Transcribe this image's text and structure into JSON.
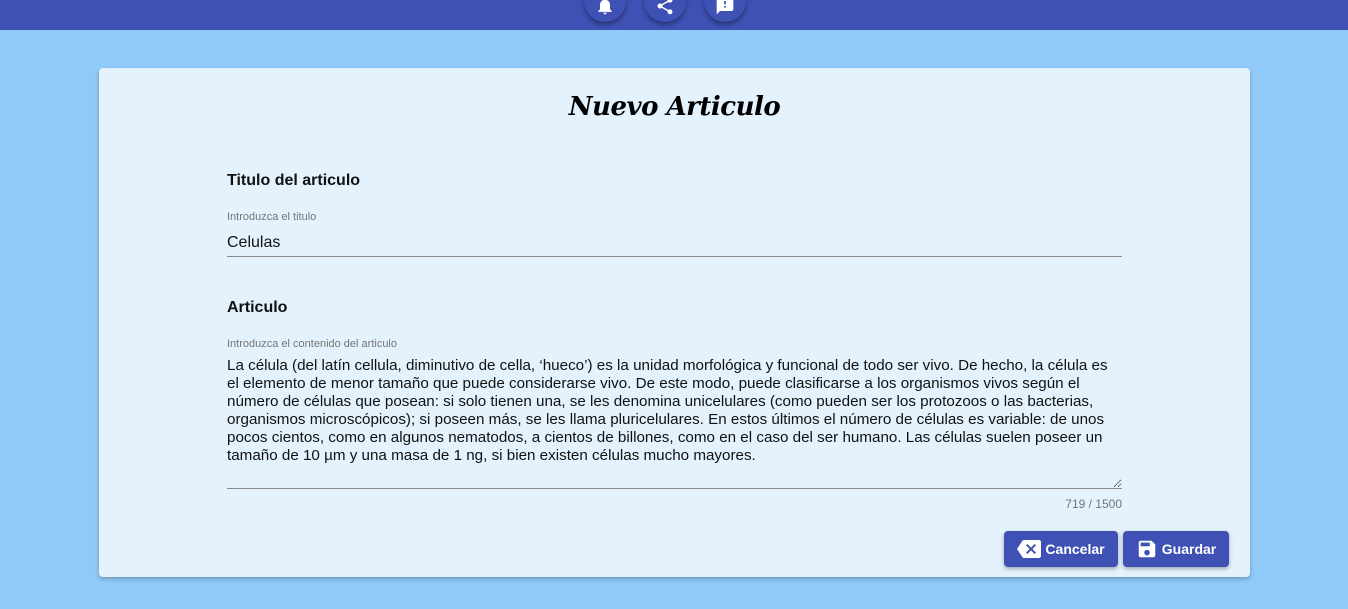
{
  "topbar": {
    "buttons": [
      {
        "icon": "bell-icon"
      },
      {
        "icon": "share-icon"
      },
      {
        "icon": "chat-icon"
      }
    ]
  },
  "form": {
    "page_title": "Nuevo Articulo",
    "title_section": {
      "label": "Titulo del articulo",
      "caption": "Introduzca el titulo",
      "value": "Celulas"
    },
    "article_section": {
      "label": "Articulo",
      "caption": "Introduzca el contenido del articulo",
      "value": "La célula (del latín cellula, diminutivo de cella, ‘hueco’) es la unidad morfológica y funcional de todo ser vivo. De hecho, la célula es el elemento de menor tamaño que puede considerarse vivo. De este modo, puede clasificarse a los organismos vivos según el número de células que posean: si solo tienen una, se les denomina unicelulares (como pueden ser los protozoos o las bacterias, organismos microscópicos); si poseen más, se les llama pluricelulares. En estos últimos el número de células es variable: de unos pocos cientos, como en algunos nematodos, a cientos de billones, como en el caso del ser humano. Las células suelen poseer un tamaño de 10 µm y una masa de 1 ng, si bien existen células mucho mayores.",
      "counter": "719 / 1500"
    },
    "cancel_label": "Cancelar",
    "save_label": "Guardar"
  },
  "colors": {
    "primary": "#3f51b5",
    "background": "#90caf9",
    "card": "#e3f2fd"
  }
}
